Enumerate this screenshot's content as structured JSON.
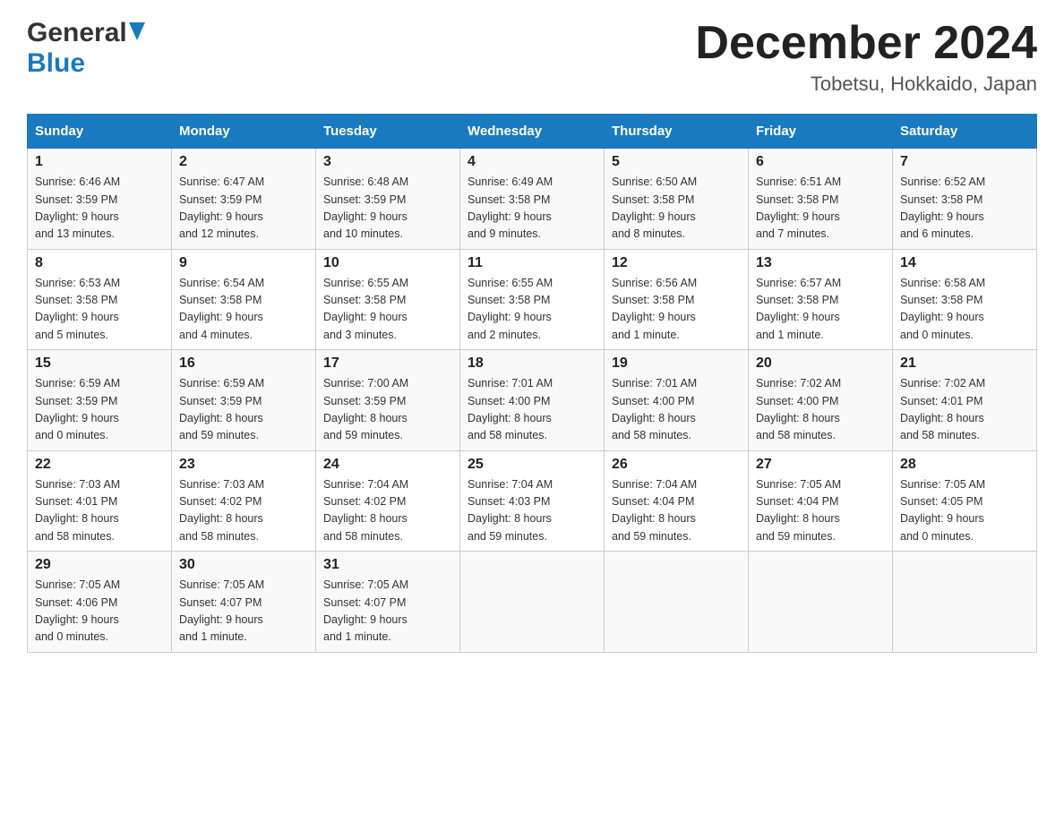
{
  "header": {
    "logo_general": "General",
    "logo_blue": "Blue",
    "title": "December 2024",
    "subtitle": "Tobetsu, Hokkaido, Japan"
  },
  "columns": [
    "Sunday",
    "Monday",
    "Tuesday",
    "Wednesday",
    "Thursday",
    "Friday",
    "Saturday"
  ],
  "weeks": [
    [
      {
        "day": "1",
        "sunrise": "Sunrise: 6:46 AM",
        "sunset": "Sunset: 3:59 PM",
        "daylight": "Daylight: 9 hours",
        "daylight2": "and 13 minutes."
      },
      {
        "day": "2",
        "sunrise": "Sunrise: 6:47 AM",
        "sunset": "Sunset: 3:59 PM",
        "daylight": "Daylight: 9 hours",
        "daylight2": "and 12 minutes."
      },
      {
        "day": "3",
        "sunrise": "Sunrise: 6:48 AM",
        "sunset": "Sunset: 3:59 PM",
        "daylight": "Daylight: 9 hours",
        "daylight2": "and 10 minutes."
      },
      {
        "day": "4",
        "sunrise": "Sunrise: 6:49 AM",
        "sunset": "Sunset: 3:58 PM",
        "daylight": "Daylight: 9 hours",
        "daylight2": "and 9 minutes."
      },
      {
        "day": "5",
        "sunrise": "Sunrise: 6:50 AM",
        "sunset": "Sunset: 3:58 PM",
        "daylight": "Daylight: 9 hours",
        "daylight2": "and 8 minutes."
      },
      {
        "day": "6",
        "sunrise": "Sunrise: 6:51 AM",
        "sunset": "Sunset: 3:58 PM",
        "daylight": "Daylight: 9 hours",
        "daylight2": "and 7 minutes."
      },
      {
        "day": "7",
        "sunrise": "Sunrise: 6:52 AM",
        "sunset": "Sunset: 3:58 PM",
        "daylight": "Daylight: 9 hours",
        "daylight2": "and 6 minutes."
      }
    ],
    [
      {
        "day": "8",
        "sunrise": "Sunrise: 6:53 AM",
        "sunset": "Sunset: 3:58 PM",
        "daylight": "Daylight: 9 hours",
        "daylight2": "and 5 minutes."
      },
      {
        "day": "9",
        "sunrise": "Sunrise: 6:54 AM",
        "sunset": "Sunset: 3:58 PM",
        "daylight": "Daylight: 9 hours",
        "daylight2": "and 4 minutes."
      },
      {
        "day": "10",
        "sunrise": "Sunrise: 6:55 AM",
        "sunset": "Sunset: 3:58 PM",
        "daylight": "Daylight: 9 hours",
        "daylight2": "and 3 minutes."
      },
      {
        "day": "11",
        "sunrise": "Sunrise: 6:55 AM",
        "sunset": "Sunset: 3:58 PM",
        "daylight": "Daylight: 9 hours",
        "daylight2": "and 2 minutes."
      },
      {
        "day": "12",
        "sunrise": "Sunrise: 6:56 AM",
        "sunset": "Sunset: 3:58 PM",
        "daylight": "Daylight: 9 hours",
        "daylight2": "and 1 minute."
      },
      {
        "day": "13",
        "sunrise": "Sunrise: 6:57 AM",
        "sunset": "Sunset: 3:58 PM",
        "daylight": "Daylight: 9 hours",
        "daylight2": "and 1 minute."
      },
      {
        "day": "14",
        "sunrise": "Sunrise: 6:58 AM",
        "sunset": "Sunset: 3:58 PM",
        "daylight": "Daylight: 9 hours",
        "daylight2": "and 0 minutes."
      }
    ],
    [
      {
        "day": "15",
        "sunrise": "Sunrise: 6:59 AM",
        "sunset": "Sunset: 3:59 PM",
        "daylight": "Daylight: 9 hours",
        "daylight2": "and 0 minutes."
      },
      {
        "day": "16",
        "sunrise": "Sunrise: 6:59 AM",
        "sunset": "Sunset: 3:59 PM",
        "daylight": "Daylight: 8 hours",
        "daylight2": "and 59 minutes."
      },
      {
        "day": "17",
        "sunrise": "Sunrise: 7:00 AM",
        "sunset": "Sunset: 3:59 PM",
        "daylight": "Daylight: 8 hours",
        "daylight2": "and 59 minutes."
      },
      {
        "day": "18",
        "sunrise": "Sunrise: 7:01 AM",
        "sunset": "Sunset: 4:00 PM",
        "daylight": "Daylight: 8 hours",
        "daylight2": "and 58 minutes."
      },
      {
        "day": "19",
        "sunrise": "Sunrise: 7:01 AM",
        "sunset": "Sunset: 4:00 PM",
        "daylight": "Daylight: 8 hours",
        "daylight2": "and 58 minutes."
      },
      {
        "day": "20",
        "sunrise": "Sunrise: 7:02 AM",
        "sunset": "Sunset: 4:00 PM",
        "daylight": "Daylight: 8 hours",
        "daylight2": "and 58 minutes."
      },
      {
        "day": "21",
        "sunrise": "Sunrise: 7:02 AM",
        "sunset": "Sunset: 4:01 PM",
        "daylight": "Daylight: 8 hours",
        "daylight2": "and 58 minutes."
      }
    ],
    [
      {
        "day": "22",
        "sunrise": "Sunrise: 7:03 AM",
        "sunset": "Sunset: 4:01 PM",
        "daylight": "Daylight: 8 hours",
        "daylight2": "and 58 minutes."
      },
      {
        "day": "23",
        "sunrise": "Sunrise: 7:03 AM",
        "sunset": "Sunset: 4:02 PM",
        "daylight": "Daylight: 8 hours",
        "daylight2": "and 58 minutes."
      },
      {
        "day": "24",
        "sunrise": "Sunrise: 7:04 AM",
        "sunset": "Sunset: 4:02 PM",
        "daylight": "Daylight: 8 hours",
        "daylight2": "and 58 minutes."
      },
      {
        "day": "25",
        "sunrise": "Sunrise: 7:04 AM",
        "sunset": "Sunset: 4:03 PM",
        "daylight": "Daylight: 8 hours",
        "daylight2": "and 59 minutes."
      },
      {
        "day": "26",
        "sunrise": "Sunrise: 7:04 AM",
        "sunset": "Sunset: 4:04 PM",
        "daylight": "Daylight: 8 hours",
        "daylight2": "and 59 minutes."
      },
      {
        "day": "27",
        "sunrise": "Sunrise: 7:05 AM",
        "sunset": "Sunset: 4:04 PM",
        "daylight": "Daylight: 8 hours",
        "daylight2": "and 59 minutes."
      },
      {
        "day": "28",
        "sunrise": "Sunrise: 7:05 AM",
        "sunset": "Sunset: 4:05 PM",
        "daylight": "Daylight: 9 hours",
        "daylight2": "and 0 minutes."
      }
    ],
    [
      {
        "day": "29",
        "sunrise": "Sunrise: 7:05 AM",
        "sunset": "Sunset: 4:06 PM",
        "daylight": "Daylight: 9 hours",
        "daylight2": "and 0 minutes."
      },
      {
        "day": "30",
        "sunrise": "Sunrise: 7:05 AM",
        "sunset": "Sunset: 4:07 PM",
        "daylight": "Daylight: 9 hours",
        "daylight2": "and 1 minute."
      },
      {
        "day": "31",
        "sunrise": "Sunrise: 7:05 AM",
        "sunset": "Sunset: 4:07 PM",
        "daylight": "Daylight: 9 hours",
        "daylight2": "and 1 minute."
      },
      {
        "day": "",
        "sunrise": "",
        "sunset": "",
        "daylight": "",
        "daylight2": ""
      },
      {
        "day": "",
        "sunrise": "",
        "sunset": "",
        "daylight": "",
        "daylight2": ""
      },
      {
        "day": "",
        "sunrise": "",
        "sunset": "",
        "daylight": "",
        "daylight2": ""
      },
      {
        "day": "",
        "sunrise": "",
        "sunset": "",
        "daylight": "",
        "daylight2": ""
      }
    ]
  ]
}
